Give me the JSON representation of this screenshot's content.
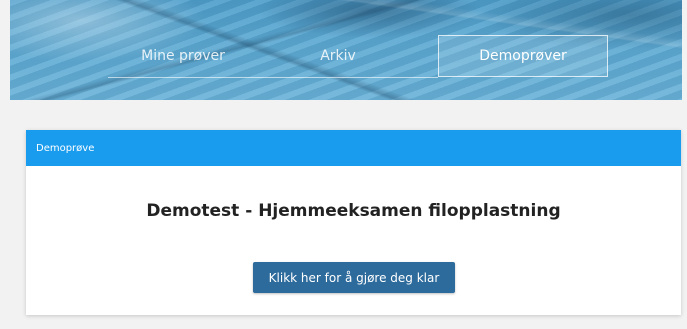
{
  "nav": {
    "tabs": [
      {
        "label": "Mine prøver",
        "active": false
      },
      {
        "label": "Arkiv",
        "active": false
      },
      {
        "label": "Demoprøver",
        "active": true
      }
    ]
  },
  "card": {
    "header": "Demoprøve",
    "title": "Demotest - Hjemmeeksamen filopplastning",
    "button_label": "Klikk her for å gjøre deg klar"
  },
  "colors": {
    "header_blue": "#1a9cee",
    "button_blue": "#2d6b9c"
  }
}
